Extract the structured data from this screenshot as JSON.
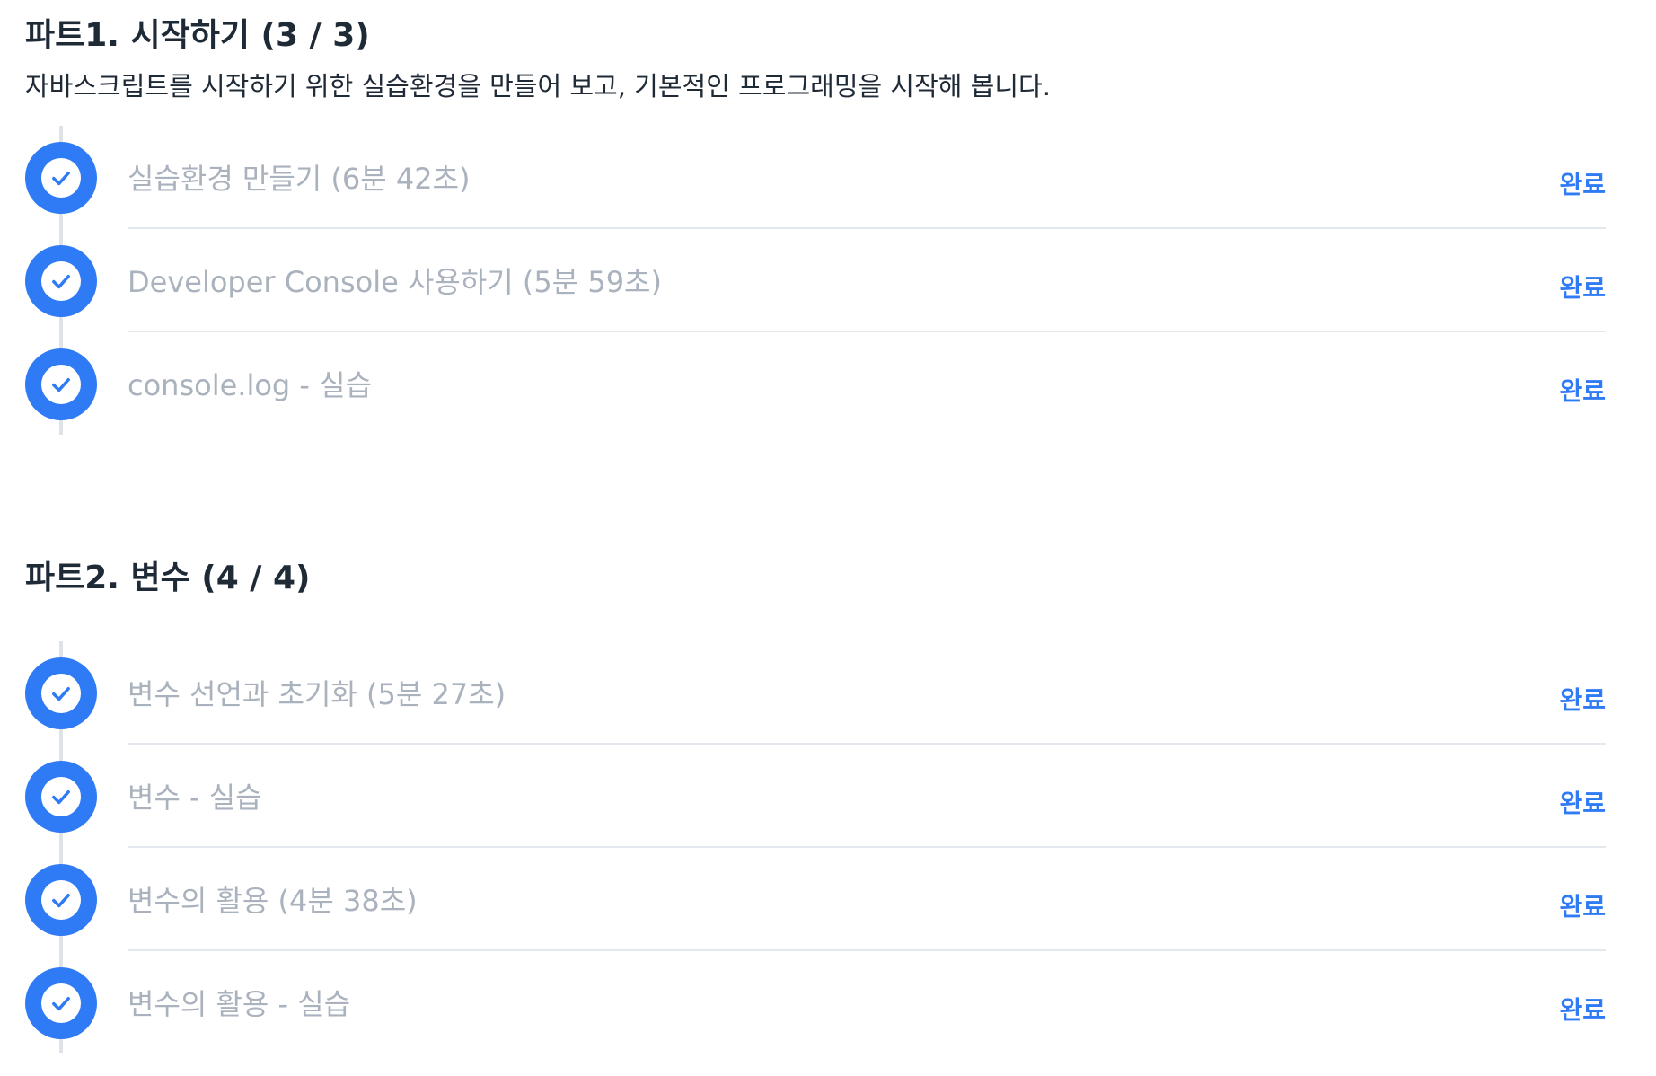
{
  "parts": [
    {
      "title": "파트1. 시작하기 (3 / 3)",
      "description": "자바스크립트를 시작하기 위한 실습환경을 만들어 보고, 기본적인 프로그래밍을 시작해 봅니다.",
      "lessons": [
        {
          "title": "실습환경 만들기 (6분 42초)",
          "status": "완료"
        },
        {
          "title": "Developer Console 사용하기 (5분 59초)",
          "status": "완료"
        },
        {
          "title": "console.log - 실습",
          "status": "완료"
        }
      ]
    },
    {
      "title": "파트2. 변수 (4 / 4)",
      "description": "",
      "lessons": [
        {
          "title": "변수 선언과 초기화 (5분 27초)",
          "status": "완료"
        },
        {
          "title": "변수 - 실습",
          "status": "완료"
        },
        {
          "title": "변수의 활용 (4분 38초)",
          "status": "완료"
        },
        {
          "title": "변수의 활용 - 실습",
          "status": "완료"
        }
      ]
    }
  ],
  "colors": {
    "accent": "#2f7bf5",
    "completed_text": "#a9b2bd",
    "heading": "#1f2a37",
    "timeline": "#dfe3e8"
  },
  "icons": {
    "completed": "checkmark-circle-icon"
  }
}
